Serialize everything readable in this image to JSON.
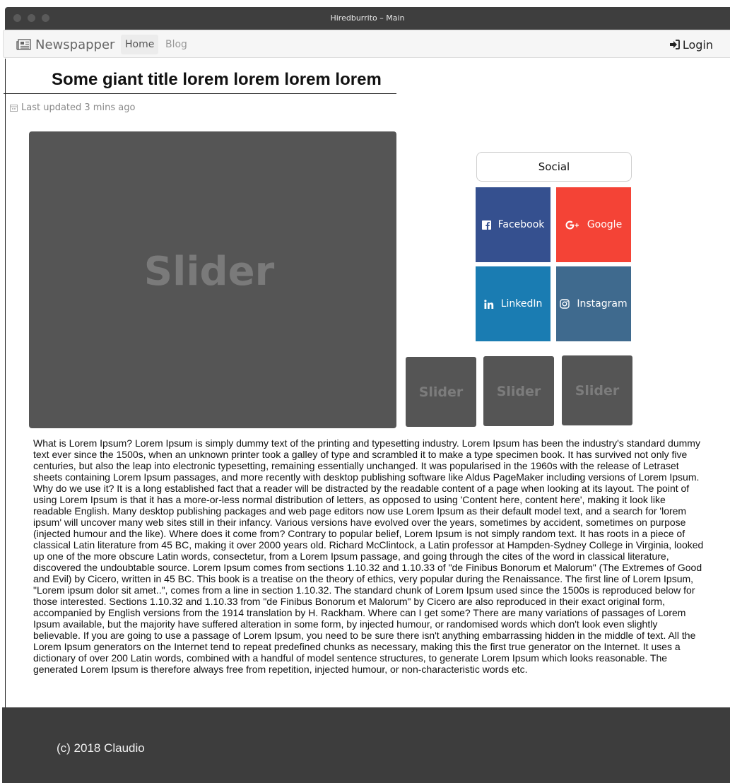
{
  "window": {
    "title": "Hiredburrito – Main"
  },
  "navbar": {
    "brand": "Newspapper",
    "brand_icon": "newspaper-icon",
    "links": [
      {
        "label": "Home",
        "active": true
      },
      {
        "label": "Blog",
        "active": false
      }
    ],
    "login_label": "Login",
    "login_icon": "sign-in-icon"
  },
  "article": {
    "title": "Some giant title lorem lorem lorem lorem",
    "updated": "Last updated 3 mins ago",
    "main_slider_label": "Slider",
    "thumbnails": [
      "Slider",
      "Slider",
      "Slider"
    ],
    "body": "What is Lorem Ipsum? Lorem Ipsum is simply dummy text of the printing and typesetting industry. Lorem Ipsum has been the industry's standard dummy text ever since the 1500s, when an unknown printer took a galley of type and scrambled it to make a type specimen book. It has survived not only five centuries, but also the leap into electronic typesetting, remaining essentially unchanged. It was popularised in the 1960s with the release of Letraset sheets containing Lorem Ipsum passages, and more recently with desktop publishing software like Aldus PageMaker including versions of Lorem Ipsum.  Why do we use it? It is a long established fact that a reader will be distracted by the readable content of a page when looking at its layout. The point of using Lorem Ipsum is that it has a more-or-less normal distribution of letters, as opposed to using 'Content here, content here', making it look like readable English. Many desktop publishing packages and web page editors now use Lorem Ipsum as their default model text, and a search for 'lorem ipsum' will uncover many web sites still in their infancy. Various versions have evolved over the years, sometimes by accident, sometimes on purpose (injected humour and the like).   Where does it come from? Contrary to popular belief, Lorem Ipsum is not simply random text. It has roots in a piece of classical Latin literature from 45 BC, making it over 2000 years old. Richard McClintock, a Latin professor at Hampden-Sydney College in Virginia, looked up one of the more obscure Latin words, consectetur, from a Lorem Ipsum passage, and going through the cites of the word in classical literature, discovered the undoubtable source. Lorem Ipsum comes from sections 1.10.32 and 1.10.33 of \"de Finibus Bonorum et Malorum\" (The Extremes of Good and Evil) by Cicero, written in 45 BC. This book is a treatise on the theory of ethics, very popular during the Renaissance. The first line of Lorem Ipsum, \"Lorem ipsum dolor sit amet..\", comes from a line in section 1.10.32.  The standard chunk of Lorem Ipsum used since the 1500s is reproduced below for those interested. Sections 1.10.32 and 1.10.33 from \"de Finibus Bonorum et Malorum\" by Cicero are also reproduced in their exact original form, accompanied by English versions from the 1914 translation by H. Rackham.  Where can I get some? There are many variations of passages of Lorem Ipsum available, but the majority have suffered alteration in some form, by injected humour, or randomised words which don't look even slightly believable. If you are going to use a passage of Lorem Ipsum, you need to be sure there isn't anything embarrassing hidden in the middle of text. All the Lorem Ipsum generators on the Internet tend to repeat predefined chunks as necessary, making this the first true generator on the Internet. It uses a dictionary of over 200 Latin words, combined with a handful of model sentence structures, to generate Lorem Ipsum which looks reasonable. The generated Lorem Ipsum is therefore always free from repetition, injected humour, or non-characteristic words etc."
  },
  "social": {
    "heading": "Social",
    "buttons": [
      {
        "label": "Facebook",
        "icon": "facebook-icon",
        "color": "#35508f"
      },
      {
        "label": "Google",
        "icon": "google-plus-icon",
        "color": "#f44336"
      },
      {
        "label": "LinkedIn",
        "icon": "linkedin-icon",
        "color": "#1a7cb2"
      },
      {
        "label": "Instagram",
        "icon": "instagram-icon",
        "color": "#3f6a8e"
      }
    ]
  },
  "footer": {
    "copyright": "(c) 2018 Claudio"
  }
}
